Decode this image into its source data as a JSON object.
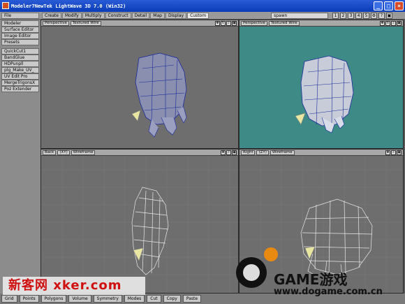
{
  "window": {
    "title": "Modeler7NewTek LightWave 3D 7.0 (Win32)"
  },
  "menubar": {
    "file_label": "File",
    "tabs": [
      "Create",
      "Modify",
      "Multiply",
      "Construct",
      "Detail",
      "Map",
      "Display",
      "Custom"
    ],
    "active_tab": "Custom",
    "spawn_value": "spawn"
  },
  "sidebar": {
    "items": [
      "Modeler",
      "Surface Editor",
      "Image Editor",
      "Presets",
      "QuickCut1",
      "BandGlue",
      "HDPunpll",
      "plg_Make_UV_",
      "UV Edit Pro",
      "MergeTrigonsX",
      "Poz Extender"
    ]
  },
  "viewports": [
    {
      "view": "Perspective",
      "mode": "Textured Wire",
      "bg": "#6e6e6e"
    },
    {
      "view": "Perspective",
      "mode": "Textured Wire",
      "bg": "#3d8a86"
    },
    {
      "view": "Back",
      "axis": "(XY)",
      "mode": "Wireframe",
      "bg": "#6e6e6e"
    },
    {
      "view": "Right",
      "axis": "(ZY)",
      "mode": "Wireframe",
      "bg": "#6e6e6e"
    }
  ],
  "bottombar": {
    "items": [
      "Grid",
      "Points",
      "Polygons",
      "Volume",
      "Symmetry",
      "Modes",
      "Cut",
      "Copy",
      "Paste"
    ]
  },
  "watermarks": {
    "left": "新客网 xker.com",
    "right_brand": "GAME游戏",
    "right_url": "www.dogame.com.cn"
  }
}
